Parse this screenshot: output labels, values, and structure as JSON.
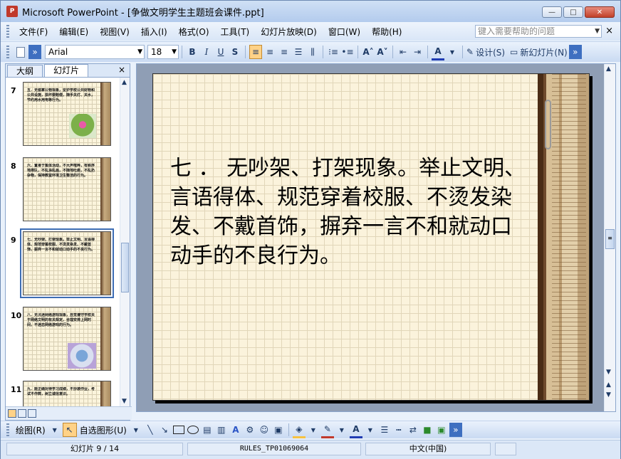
{
  "window": {
    "title": "Microsoft PowerPoint - [争做文明学生主题班会课件.ppt]",
    "buttons": {
      "minimize": "—",
      "maximize": "□",
      "close": "✕"
    }
  },
  "menu": {
    "items": [
      "文件(F)",
      "编辑(E)",
      "视图(V)",
      "插入(I)",
      "格式(O)",
      "工具(T)",
      "幻灯片放映(D)",
      "窗口(W)",
      "帮助(H)"
    ],
    "help_placeholder": "键入需要帮助的问题",
    "close": "×"
  },
  "toolbar": {
    "font": "Arial",
    "size": "18",
    "bold": "B",
    "italic": "I",
    "underline": "U",
    "shadow": "S",
    "design": "设计(S)",
    "new_slide": "新幻灯片(N)"
  },
  "pane": {
    "tabs": [
      "大纲",
      "幻灯片"
    ],
    "close": "×"
  },
  "thumbnails": [
    {
      "num": "7",
      "text": "五．无偷拿公物现象，爱护学校公共财物和公共设施，损坏要赔偿，随手关灯、关水，节约用水用电等行为。",
      "image": "flower"
    },
    {
      "num": "8",
      "text": "六．置身于集体活动，不大声喧哗，有秩序地排队，不乱涂乱画，不随地吐痰，不乱扔杂物，保持教室环境卫生整洁的行为。",
      "image": ""
    },
    {
      "num": "9",
      "text": "七．无吵架、打架现象。举止文明、言语得体、规范穿着校服、不烫发染发、不戴首饰，摒弃一言不和就动口动手的不良行为。",
      "image": ""
    },
    {
      "num": "10",
      "text": "八．无沉迷网络游戏现象，自觉遵守学校关于网络文明的有关规定，合理安排上网时间，不迷恋网络游戏的行为。",
      "image": "tech"
    },
    {
      "num": "11",
      "text": "九．能正确对待学习成绩，不抄袭作业，考试不作弊，树立诚信意识。",
      "image": ""
    }
  ],
  "slide": {
    "text": "七 ． 无吵架、打架现象。举止文明、言语得体、规范穿着校服、不烫发染发、不戴首饰，摒弃一言不和就动口动手的不良行为。"
  },
  "drawbar": {
    "draw": "绘图(R)",
    "autoshapes": "自选图形(U)"
  },
  "status": {
    "slide": "幻灯片 9 / 14",
    "design": "RULES_TP01069064",
    "language": "中文(中国)"
  }
}
